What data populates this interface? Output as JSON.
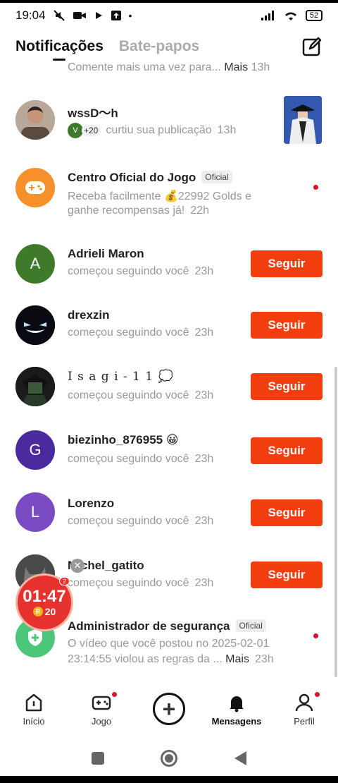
{
  "status": {
    "time": "19:04",
    "battery": "52"
  },
  "header": {
    "tabs": [
      "Notificações",
      "Bate-papos"
    ]
  },
  "partial": {
    "text": "Comente mais uma vez para...",
    "more": "Mais",
    "time": "13h"
  },
  "items": [
    {
      "name": "wssD〜h",
      "likes_count": "+20",
      "desc": "curtiu sua publicação",
      "time": "13h"
    },
    {
      "name": "Centro Oficial do Jogo",
      "badge": "Oficial",
      "desc1": "Receba facilmente 💰22992 Golds e",
      "desc2": "ganhe recompensas já!",
      "time": "22h"
    },
    {
      "name": "Adrieli Maron",
      "initial": "A",
      "color": "#3e7a2a",
      "desc": "começou seguindo você",
      "time": "23h",
      "button": "Seguir"
    },
    {
      "name": "drexzin",
      "desc": "começou seguindo você",
      "time": "23h",
      "button": "Seguir"
    },
    {
      "name": "I s a g i - 1 1 💭",
      "desc": "começou seguindo você",
      "time": "23h",
      "button": "Seguir"
    },
    {
      "name": "biezinho_876955 😀",
      "initial": "G",
      "color": "#4b2a9e",
      "desc": "começou seguindo você",
      "time": "23h",
      "button": "Seguir"
    },
    {
      "name": "Lorenzo",
      "initial": "L",
      "color": "#7a4bc2",
      "desc": "começou seguindo você",
      "time": "23h",
      "button": "Seguir"
    },
    {
      "name": "Michel_gatito",
      "desc": "começou seguindo você",
      "time": "23h",
      "button": "Seguir"
    },
    {
      "name": "Administrador de segurança",
      "badge": "Oficial",
      "desc1": "O vídeo que você postou no 2025-02-01",
      "desc2": "23:14:55 violou as regras da ...",
      "more": "Mais",
      "time": "23h"
    }
  ],
  "timer": {
    "clock": "01:47",
    "points": "20",
    "count": "2",
    "coin": "R"
  },
  "nav": [
    {
      "label": "Início"
    },
    {
      "label": "Jogo"
    },
    {
      "label": "Mensagens"
    },
    {
      "label": "Perfil"
    }
  ],
  "colors": {
    "accent": "#f23d0f",
    "dot": "#e0102a"
  }
}
